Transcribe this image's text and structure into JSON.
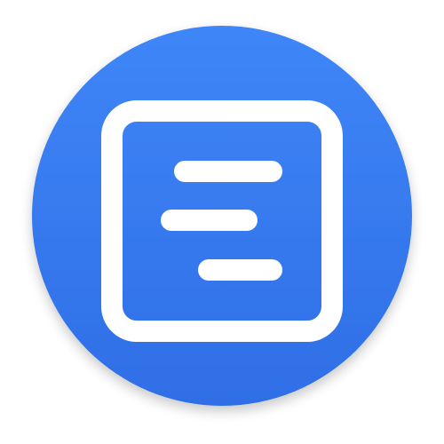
{
  "icon": {
    "name": "document-lines-app-icon",
    "glyph": "square-with-three-text-lines",
    "colors": {
      "circle_top": "#3f86f8",
      "circle_bottom": "#2f6ee6",
      "glyph": "#ffffff",
      "shadow": "#1e3a8a"
    }
  }
}
